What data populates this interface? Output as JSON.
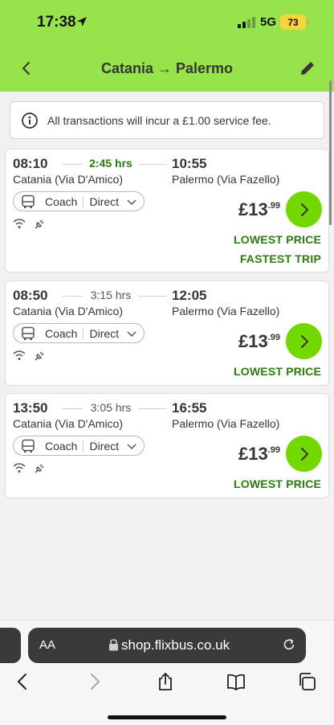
{
  "status_bar": {
    "time": "17:38",
    "network": "5G",
    "battery": "73"
  },
  "header": {
    "title": "Catania → Palermo",
    "back_icon": "chevron-left-icon",
    "edit_icon": "pencil-icon"
  },
  "notice": {
    "icon": "info-icon",
    "text": "All transactions will incur a £1.00 service fee."
  },
  "trips": [
    {
      "departure_time": "08:10",
      "duration": "2:45 hrs",
      "arrival_time": "10:55",
      "departure_station": "Catania (Via D'Amico)",
      "arrival_station": "Palermo (Via Fazello)",
      "vehicle": "Coach",
      "route_type": "Direct",
      "price_main": "£13",
      "price_cents": ".99",
      "tags": [
        "LOWEST PRICE",
        "FASTEST TRIP"
      ]
    },
    {
      "departure_time": "08:50",
      "duration": "3:15 hrs",
      "arrival_time": "12:05",
      "departure_station": "Catania (Via D'Amico)",
      "arrival_station": "Palermo (Via Fazello)",
      "vehicle": "Coach",
      "route_type": "Direct",
      "price_main": "£13",
      "price_cents": ".99",
      "tags": [
        "LOWEST PRICE"
      ]
    },
    {
      "departure_time": "13:50",
      "duration": "3:05 hrs",
      "arrival_time": "16:55",
      "departure_station": "Catania (Via D'Amico)",
      "arrival_station": "Palermo (Via Fazello)",
      "vehicle": "Coach",
      "route_type": "Direct",
      "price_main": "£13",
      "price_cents": ".99",
      "tags": [
        "LOWEST PRICE"
      ]
    }
  ],
  "browser": {
    "text_size_label": "AA",
    "url": "shop.flixbus.co.uk"
  },
  "colors": {
    "brand_green": "#73d700",
    "header_green": "#97e34b",
    "tag_green": "#2a7c0e"
  }
}
